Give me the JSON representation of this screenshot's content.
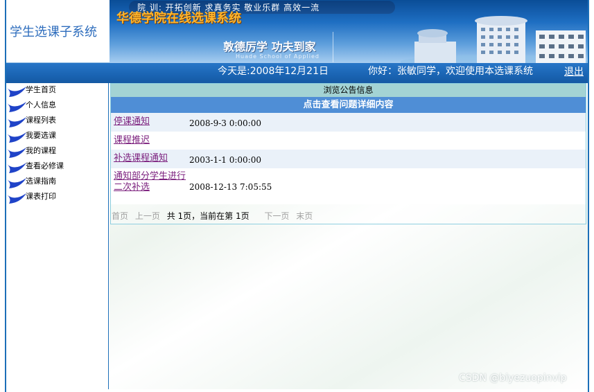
{
  "header": {
    "system_title": "学生选课子系统",
    "motto": "院  训: 开拓创新 求真务实 敬业乐群 高效一流",
    "banner_title": "华德学院在线选课系统",
    "slogan": "敦德厉学 功夫到家",
    "school_en": "Huade School of Applied"
  },
  "infobar": {
    "date_text": "今天是:2008年12月21日",
    "welcome_text": "你好：张敏同学，欢迎使用本选课系统",
    "logout_label": "退出"
  },
  "sidebar": {
    "items": [
      {
        "label": "学生首页"
      },
      {
        "label": "个人信息"
      },
      {
        "label": "课程列表"
      },
      {
        "label": "我要选课"
      },
      {
        "label": "我的课程"
      },
      {
        "label": "查看必修课"
      },
      {
        "label": "选课指南"
      },
      {
        "label": "课表打印"
      }
    ]
  },
  "main": {
    "panel_title": "浏览公告信息",
    "table_header": "点击查看问题详细内容",
    "announcements": [
      {
        "title": "停课通知",
        "time": "2008-9-3 0:00:00"
      },
      {
        "title": "课程推迟",
        "time": ""
      },
      {
        "title": "补选课程通知",
        "time": "2003-1-1 0:00:00"
      },
      {
        "title": "通知部分学生进行二次补选",
        "time": "2008-12-13 7:05:55"
      }
    ],
    "pager": {
      "first": "首页",
      "prev": "上一页",
      "info": "共 1页，当前在第 1页",
      "next": "下一页",
      "last": "末页"
    }
  },
  "watermark": "CSDN @biyezuopinvip",
  "colors": {
    "frame_border": "#1c6fb8",
    "infobar_bg": "#1a64b3",
    "table_header_bg": "#4f8ed6",
    "panel_title_bg": "#a3d3d4",
    "link_color": "#7b1f7d",
    "banner_title_color": "#ffb52b",
    "system_title_color": "#2e6dbd"
  },
  "icons": {
    "menu_item_icon": "blue-swoosh-arrow-icon"
  }
}
